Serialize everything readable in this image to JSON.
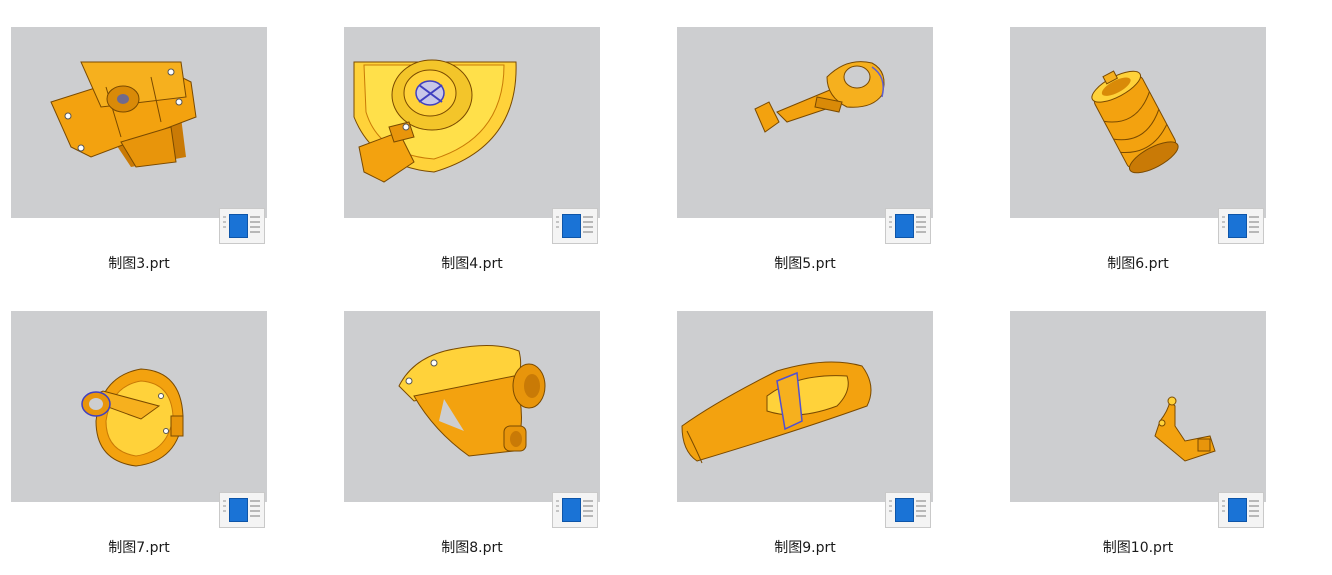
{
  "files": [
    {
      "name": "制图3.prt",
      "thumb_icon": "part-bracket-thumbnail"
    },
    {
      "name": "制图4.prt",
      "thumb_icon": "part-disc-thumbnail"
    },
    {
      "name": "制图5.prt",
      "thumb_icon": "part-lever-thumbnail"
    },
    {
      "name": "制图6.prt",
      "thumb_icon": "part-cylinder-thumbnail"
    },
    {
      "name": "制图7.prt",
      "thumb_icon": "part-flange-tube-thumbnail"
    },
    {
      "name": "制图8.prt",
      "thumb_icon": "part-housing-thumbnail"
    },
    {
      "name": "制图9.prt",
      "thumb_icon": "part-bucket-tooth-thumbnail"
    },
    {
      "name": "制图10.prt",
      "thumb_icon": "part-small-link-thumbnail"
    }
  ],
  "colors": {
    "thumb_background": "#cdced0",
    "part_orange": "#f3a20f",
    "part_shadow": "#c97a06",
    "part_highlight": "#ffd23a",
    "file_badge_blue": "#1a73d6"
  }
}
